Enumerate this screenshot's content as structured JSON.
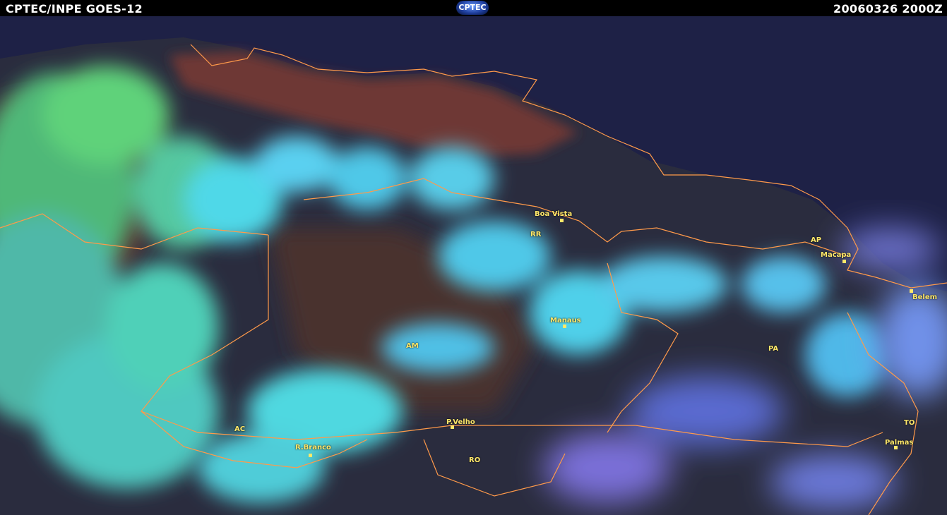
{
  "header": {
    "left_title": "CPTEC/INPE  GOES-12",
    "logo_text": "CPTEC",
    "timestamp": "20060326  2000Z"
  },
  "colors": {
    "ocean": "#1e2146",
    "land": "#7a3a36",
    "cloud_cyan": "#4fd8e8",
    "cloud_green": "#5fd27a",
    "cloud_violet": "#7a70d8",
    "borders": "#ff9a4a",
    "labels": "#ffe86a"
  },
  "map": {
    "states": [
      {
        "id": "rr",
        "text": "RR"
      },
      {
        "id": "ap",
        "text": "AP"
      },
      {
        "id": "am",
        "text": "AM"
      },
      {
        "id": "pa",
        "text": "PA"
      },
      {
        "id": "ac",
        "text": "AC"
      },
      {
        "id": "ro",
        "text": "RO"
      },
      {
        "id": "to",
        "text": "TO"
      }
    ],
    "cities": [
      {
        "id": "boa-vista",
        "text": "Boa Vista"
      },
      {
        "id": "macapa",
        "text": "Macapa"
      },
      {
        "id": "belem",
        "text": "Belem"
      },
      {
        "id": "manaus",
        "text": "Manaus"
      },
      {
        "id": "p-velho",
        "text": "P.Velho"
      },
      {
        "id": "r-branco",
        "text": "R.Branco"
      },
      {
        "id": "palmas",
        "text": "Palmas"
      }
    ]
  }
}
